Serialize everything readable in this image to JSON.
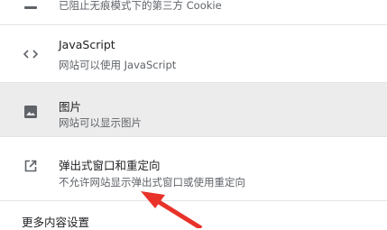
{
  "settings": {
    "items": [
      {
        "title": "",
        "subtitle": "已阻止无痕模式下的第三方 Cookie",
        "icon": "cookie-icon"
      },
      {
        "title": "JavaScript",
        "subtitle": "网站可以使用 JavaScript",
        "icon": "code-brackets-icon"
      },
      {
        "title": "图片",
        "subtitle": "网站可以显示图片",
        "icon": "image-icon"
      },
      {
        "title": "弹出式窗口和重定向",
        "subtitle": "不允许网站显示弹出式窗口或使用重定向",
        "icon": "open-in-new-icon"
      }
    ],
    "more_label": "更多内容设置"
  },
  "colors": {
    "highlight_row": "#ececec",
    "annotation_arrow": "#e8322a"
  }
}
